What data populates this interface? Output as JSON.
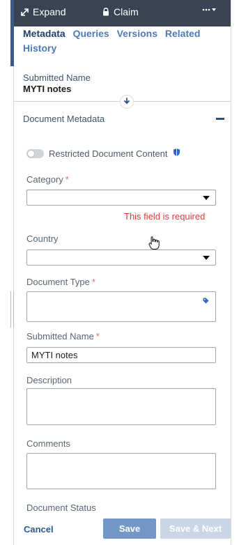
{
  "window": {
    "expand_label": "Expand",
    "claim_label": "Claim"
  },
  "tabs": [
    {
      "label": "Metadata",
      "active": true
    },
    {
      "label": "Queries",
      "active": false
    },
    {
      "label": "Versions",
      "active": false
    },
    {
      "label": "Related",
      "active": false
    },
    {
      "label": "History",
      "active": false
    }
  ],
  "summary": {
    "label": "Submitted Name",
    "value": "MYTI notes"
  },
  "section": {
    "title": "Document Metadata"
  },
  "toggle": {
    "label": "Restricted Document Content",
    "on": false
  },
  "fields": {
    "category_label": "Category",
    "category_required": "*",
    "category_value": "",
    "category_error": "This field is required",
    "country_label": "Country",
    "country_value": "",
    "document_type_label": "Document Type",
    "document_type_required": "*",
    "submitted_name_label": "Submitted Name",
    "submitted_name_required": "*",
    "submitted_name_value": "MYTI notes",
    "description_label": "Description",
    "comments_label": "Comments",
    "document_status_label": "Document Status"
  },
  "footer": {
    "cancel_label": "Cancel",
    "save_label": "Save",
    "save_next_label": "Save & Next"
  },
  "colors": {
    "topbar": "#3a4351",
    "accent": "#3d5a8a",
    "link": "#4f7bb3",
    "error": "#df3b3b",
    "save": "#7398c7",
    "save_next": "#c8d6e6"
  },
  "icons": {
    "expand": "expand-icon",
    "claim": "lock-icon",
    "more": "more-icon",
    "collapse": "arrow-down-icon",
    "section": "minus-icon",
    "shield": "shield-icon",
    "tag": "tag-icon",
    "cursor": "hand-pointer-icon"
  }
}
